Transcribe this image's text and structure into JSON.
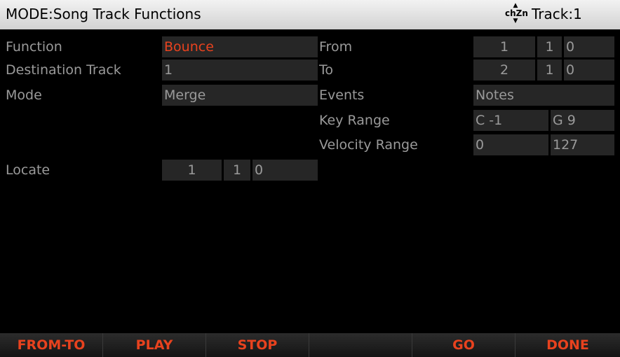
{
  "header": {
    "title": "MODE:Song Track Functions",
    "chzn_label": "chZn",
    "track": "Track:1"
  },
  "left": {
    "function_label": "Function",
    "function_value": "Bounce",
    "dest_label": "Destination Track",
    "dest_value": "1",
    "mode_label": "Mode",
    "mode_value": "Merge",
    "locate_label": "Locate",
    "locate_bar": "1",
    "locate_beat": "1",
    "locate_tick": "0"
  },
  "right": {
    "from_label": "From",
    "from_bar": "1",
    "from_beat": "1",
    "from_tick": "0",
    "to_label": "To",
    "to_bar": "2",
    "to_beat": "1",
    "to_tick": "0",
    "events_label": "Events",
    "events_value": "Notes",
    "keyrange_label": "Key Range",
    "key_low": "C -1",
    "key_high": "G 9",
    "velrange_label": "Velocity Range",
    "vel_low": "0",
    "vel_high": "127"
  },
  "softkeys": [
    "FROM-TO",
    "PLAY",
    "STOP",
    "",
    "GO",
    "DONE"
  ],
  "colors": {
    "highlight": "#e8421e",
    "cell_bg": "#262626",
    "text": "#9a9a9a"
  }
}
